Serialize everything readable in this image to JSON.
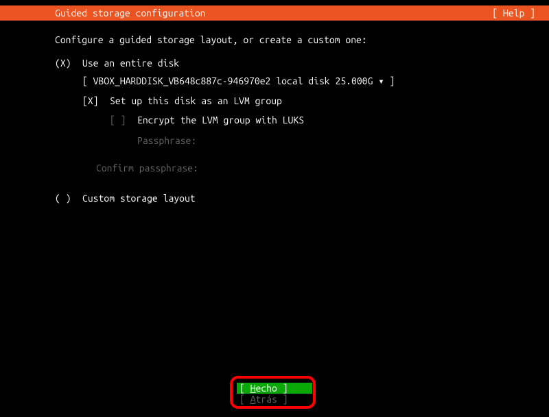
{
  "header": {
    "title": "Guided storage configuration",
    "help": "[ Help ]"
  },
  "prompt": "Configure a guided storage layout, or create a custom one:",
  "options": {
    "entire_disk": {
      "radio": "(X)",
      "label": "Use an entire disk",
      "disk_selector": "[ VBOX_HARDDISK_VB648c887c-946970e2 local disk 25.000G ▾ ]",
      "lvm": {
        "check": "[X]",
        "label": "Set up this disk as an LVM group",
        "encrypt": {
          "check": "[ ]",
          "label": "Encrypt the LVM group with LUKS",
          "passphrase_label": "Passphrase:",
          "confirm_label": "Confirm passphrase:"
        }
      }
    },
    "custom": {
      "radio": "( )",
      "label": "Custom storage layout"
    }
  },
  "buttons": {
    "done_open": "[ ",
    "done_text": "Hecho",
    "done_close": "      ]",
    "back_open": "[ ",
    "back_text": "Atrás",
    "back_close": "      ]"
  }
}
